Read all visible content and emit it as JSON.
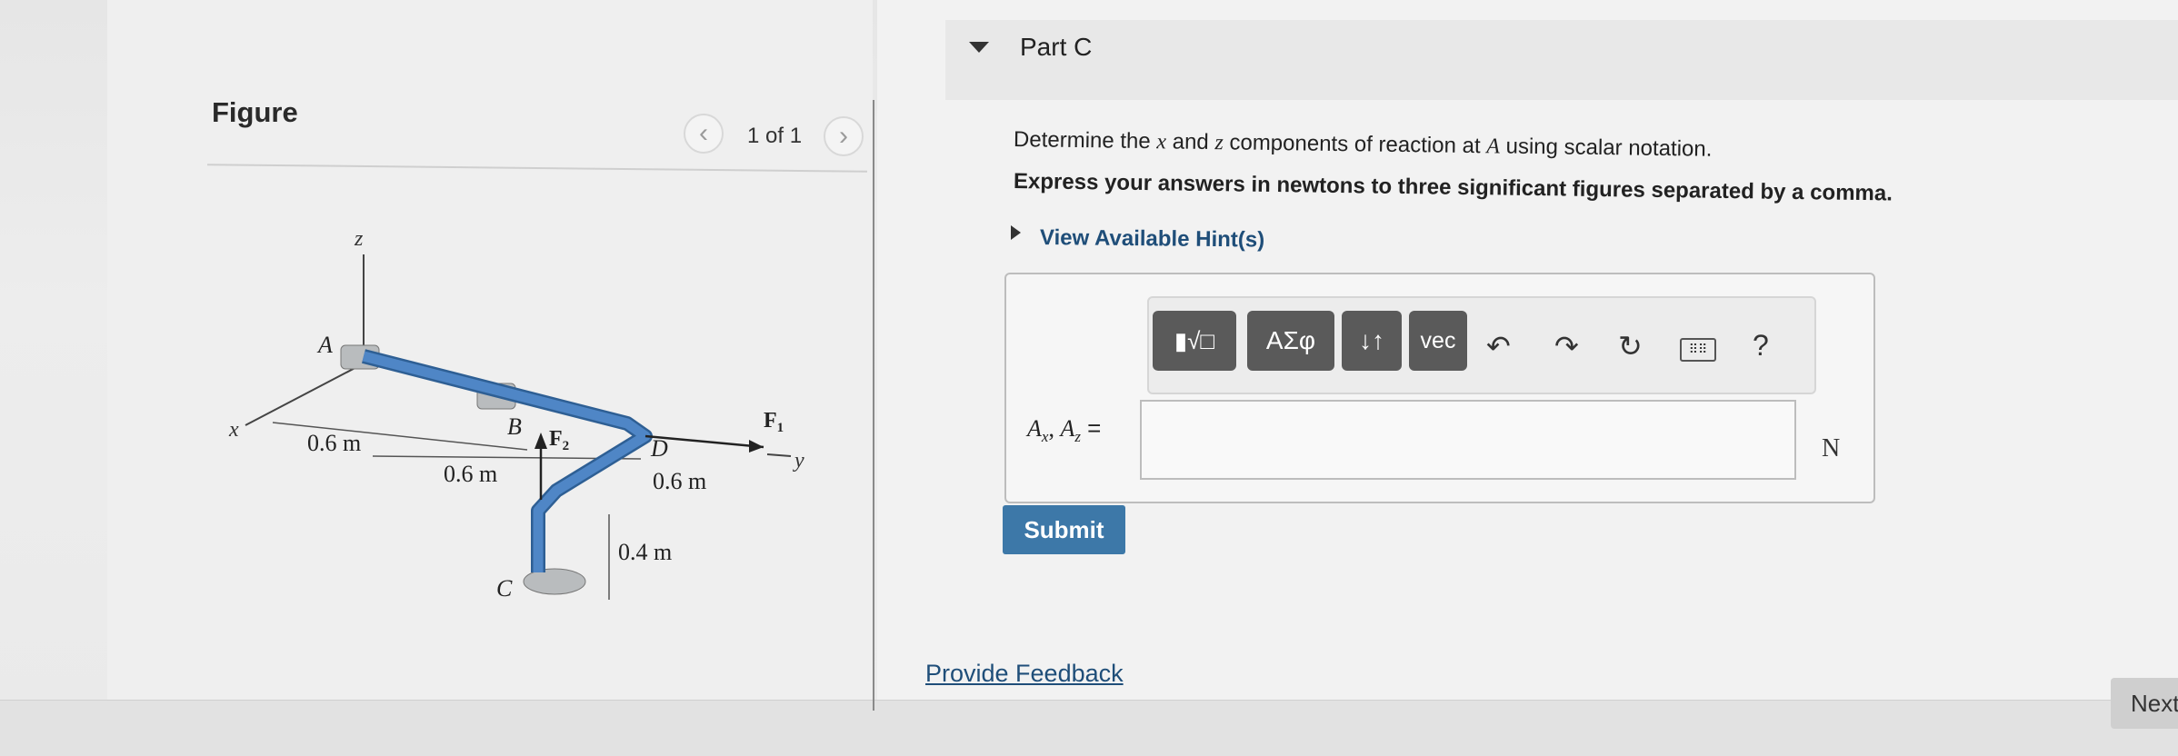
{
  "figure_panel": {
    "title": "Figure",
    "pager": {
      "prev_icon": "chevron-left-icon",
      "next_icon": "chevron-right-icon",
      "count_text": "1 of 1"
    },
    "diagram": {
      "axis_z": "z",
      "axis_x": "x",
      "axis_y": "y",
      "point_a": "A",
      "point_b": "B",
      "point_c": "C",
      "point_d": "D",
      "force_f1": "F",
      "force_f1_sub": "1",
      "force_f2": "F",
      "force_f2_sub": "2",
      "dim_ab": "0.6 m",
      "dim_bd": "0.6 m",
      "dim_d": "0.6 m",
      "dim_c": "0.4 m",
      "rod_color": "#4f86c6"
    }
  },
  "part": {
    "title": "Part C",
    "question_prefix": "Determine the ",
    "question_x": "x",
    "question_mid": " and ",
    "question_z": "z",
    "question_mid2": " components of reaction at ",
    "question_a": "A",
    "question_suffix": " using scalar notation.",
    "instruction": "Express your answers in newtons to three significant figures separated by a comma.",
    "hint_link": "View Available Hint(s)"
  },
  "toolbar": {
    "buttons": [
      {
        "name": "templates-button",
        "label": "▮√□"
      },
      {
        "name": "greek-symbols-button",
        "label": "ΑΣφ"
      },
      {
        "name": "sort-button",
        "label": "↓↑"
      },
      {
        "name": "vector-button",
        "label": "vec"
      }
    ],
    "undo_icon": "undo-icon",
    "redo_icon": "redo-icon",
    "reset_icon": "reset-icon",
    "keyboard_icon": "keyboard-icon",
    "help_label": "?"
  },
  "answer": {
    "label_a": "A",
    "label_x": "x",
    "label_sep": ", ",
    "label_a2": "A",
    "label_z": "z",
    "label_eq": " =",
    "value": "",
    "unit": "N"
  },
  "submit_label": "Submit",
  "feedback_link": "Provide Feedback",
  "next_label": "Next",
  "colors": {
    "submit": "#3d78a8",
    "link": "#1f4e79",
    "toolbar_button": "#5a5a5a"
  }
}
